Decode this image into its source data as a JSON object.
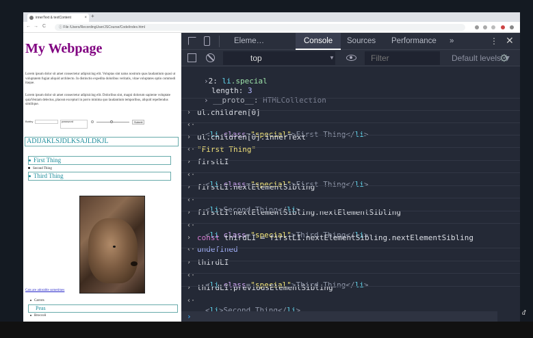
{
  "browser": {
    "tab_title": "innerText & textContent",
    "tab_close": "×",
    "new_tab": "+",
    "address_prefix": "File",
    "address_path": "/Users/RecordingUser/JSCourse/Code/index.html",
    "nav_back": "←",
    "nav_forward": "→",
    "nav_reload": "C",
    "nav_info": "ⓘ"
  },
  "webpage": {
    "title": "My Webpage",
    "para1": "Lorem ipsum dolor sit amet consectetur adipisicing elit. Voluptas sint natus nostrum quas laudantium quasi ut voluptatem fugiat aliquid architecto. In distinctio expedita doloribus veritatis, vitae voluptates optio commodi itaque.",
    "para2": "Lorem ipsum dolor sit amet consectetur adipisicing elit. Doloribus sint, magni dolorum sapiente voluptate quiaVeniam delectus, placeat excepturi in porro minima quo laudantium temporibus, aliquid repellendus similique.",
    "form_label_1": "Bobby",
    "form_label_2": "password",
    "form_label_3": "Submit",
    "big_heading": "ADIJAKLSJDLKSAJLDKJL",
    "list_items": [
      "First Thing",
      "Second Thing",
      "Third Thing"
    ],
    "image_link": "Cats are adorable sometimes",
    "veg_items": [
      "Carrots",
      "Peas",
      "Broccoli"
    ]
  },
  "devtools": {
    "tabs": [
      "Eleme…",
      "Console",
      "Sources",
      "Performance",
      "»"
    ],
    "menu_icon": "⋮",
    "close_icon": "✕",
    "context": "top",
    "context_arrow": "▼",
    "filter_placeholder": "Filter",
    "levels": "Default levels ▼",
    "gear": "⚙",
    "input_caret": "›",
    "lines": {
      "l0_idx": "2",
      "l0_tag": "li",
      "l0_cls": "special",
      "l1_key": "length",
      "l1_val": "3",
      "l2_proto": "__proto__",
      "l2_val": "HTMLCollection",
      "l3": "ul.children[0]",
      "l4_text": "First Thing",
      "l5": "ul.children[0].innerText",
      "l6": "\"First Thing\"",
      "l7": "firstLI",
      "l8_text": "First Thing",
      "l9": "firstLI.nextElementSibling",
      "l10_text": "Second Thing",
      "l11": "firstLI.nextElementSibling.nextElementSibling",
      "l12_text": "Third Thing",
      "l13_kw": "const",
      "l13_rest": " thirdLI = firstLI.nextElementSibling.nextElementSibling",
      "l14": "undefined",
      "l15": "thirdLI",
      "l16_text": "Third Thing",
      "l17": "thirdLI.previousElementSibling",
      "l18_text": "Second Thing",
      "li_open": "<",
      "li_close_open": "</",
      "gt": ">",
      "li": "li",
      "class_attr": "class",
      "special": "\"special\"",
      "eq": "="
    }
  },
  "corner_logo": "ᵭ"
}
